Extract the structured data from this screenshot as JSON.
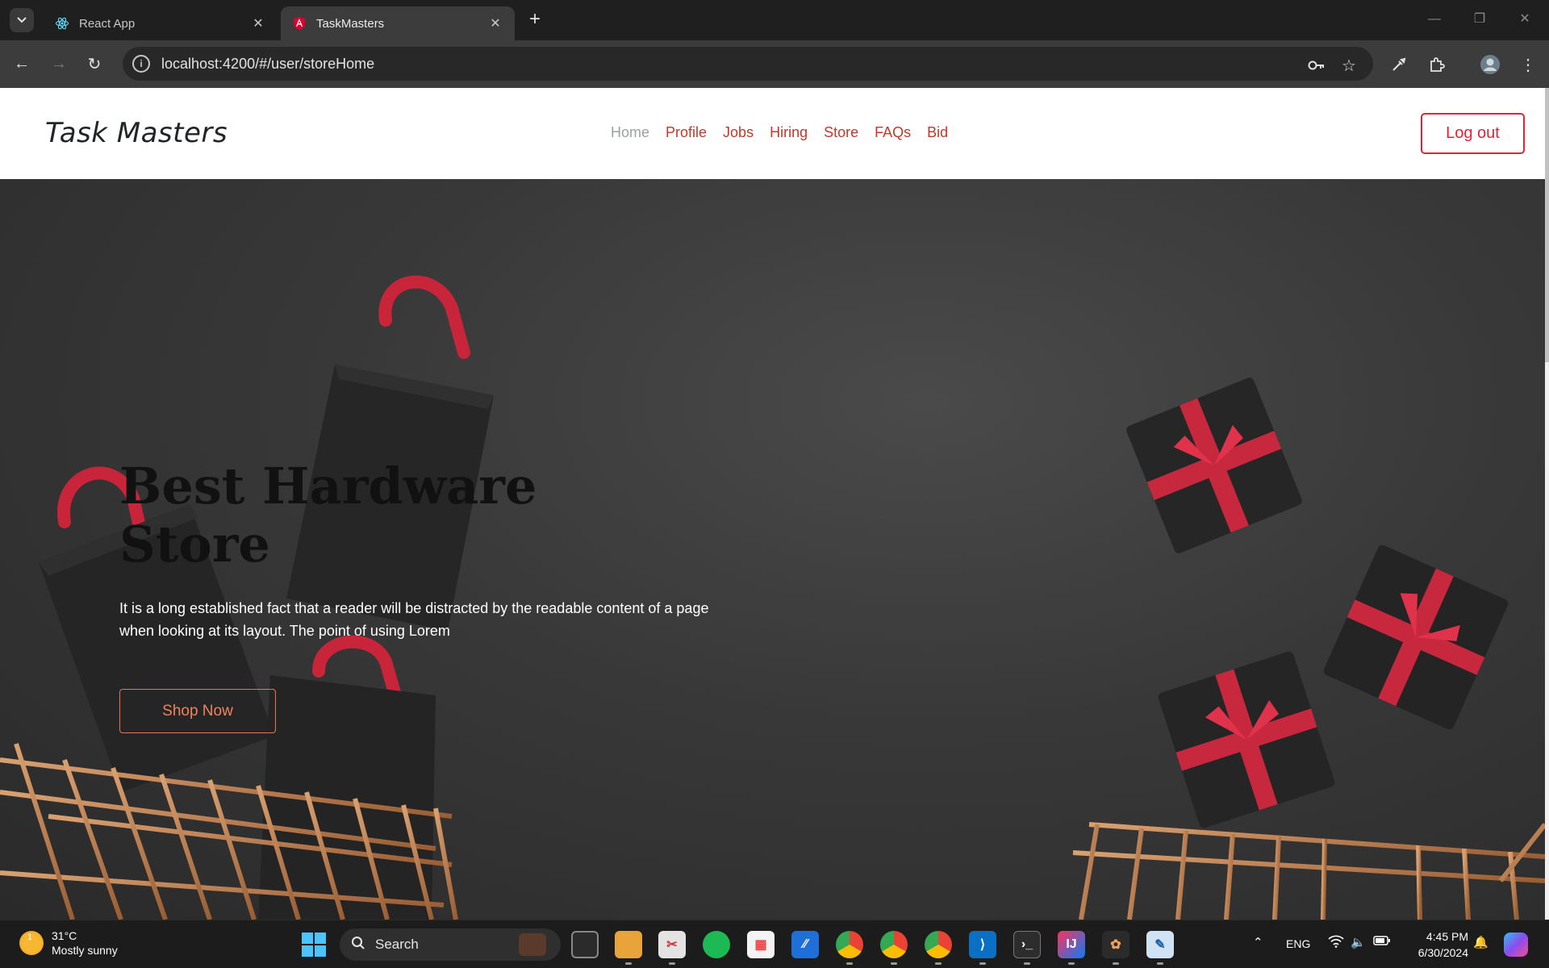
{
  "browser": {
    "tabs": [
      {
        "title": "React App",
        "active": false
      },
      {
        "title": "TaskMasters",
        "active": true
      }
    ],
    "url": "localhost:4200/#/user/storeHome"
  },
  "site": {
    "brand": "Task Masters",
    "nav": [
      "Home",
      "Profile",
      "Jobs",
      "Hiring",
      "Store",
      "FAQs",
      "Bid"
    ],
    "active_nav": "Home",
    "logout_label": "Log out"
  },
  "hero": {
    "title": "Best Hardware Store",
    "text": "It is a long established fact that a reader will be distracted by the readable content of a page when looking at its layout. The point of using Lorem",
    "button_label": "Shop Now"
  },
  "taskbar": {
    "weather_temp": "31°C",
    "weather_condition": "Mostly sunny",
    "weather_badge": "1",
    "search_placeholder": "Search",
    "language": "ENG",
    "time": "4:45 PM",
    "date": "6/30/2024"
  },
  "colors": {
    "accent": "#d9263b",
    "nav_link": "#c0392b",
    "shop_button": "#f0825e"
  }
}
